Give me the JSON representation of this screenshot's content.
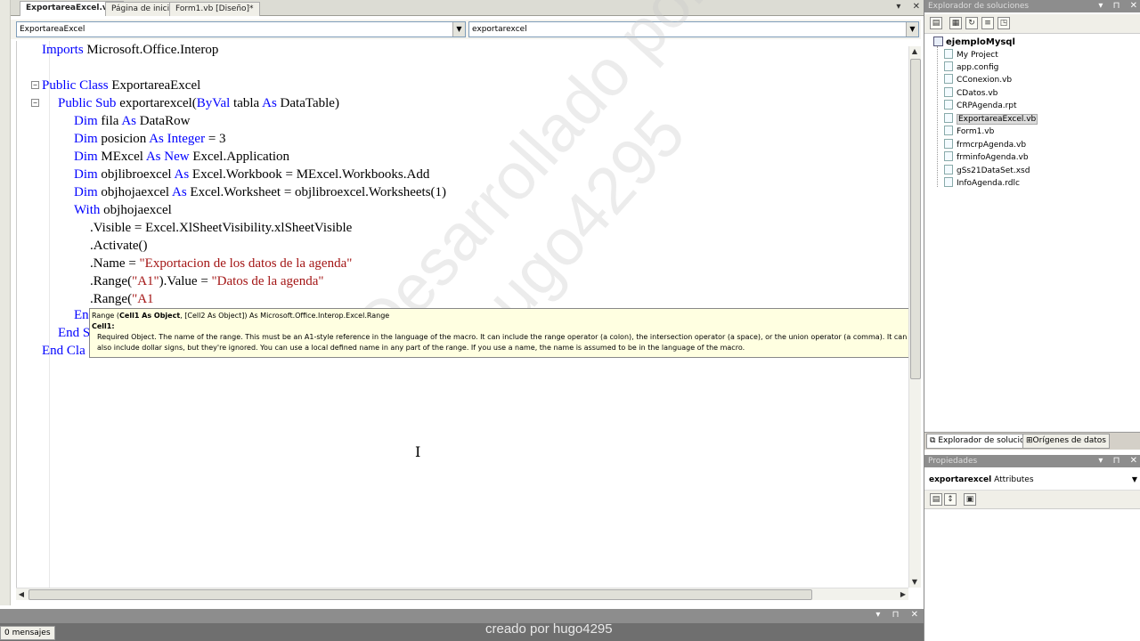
{
  "tabs": [
    {
      "label": "ExportareaExcel.vb*",
      "active": true
    },
    {
      "label": "Página de inicio",
      "active": false
    },
    {
      "label": "Form1.vb [Diseño]*",
      "active": false
    }
  ],
  "navbar": {
    "class_combo": "ExportareaExcel",
    "member_combo": "exportarexcel"
  },
  "code": {
    "l1_kw": "Imports",
    "l1_rest": " Microsoft.Office.Interop",
    "l2_kw": "Public Class",
    "l2_rest": " ExportareaExcel",
    "l3_kw": "Public Sub",
    "l3_rest": " exportarexcel(",
    "l3_kw2": "ByVal",
    "l3_rest2": " tabla ",
    "l3_kw3": "As",
    "l3_rest3": " DataTable)",
    "l4_kw": "Dim",
    "l4_rest": " fila ",
    "l4_kw2": "As",
    "l4_rest2": " DataRow",
    "l5_kw": "Dim",
    "l5_rest": " posicion ",
    "l5_kw2": "As Integer",
    "l5_rest2": " = 3",
    "l6_kw": "Dim",
    "l6_rest": " MExcel ",
    "l6_kw2": "As New",
    "l6_rest2": " Excel.Application",
    "l7_kw": "Dim",
    "l7_rest": " objlibroexcel ",
    "l7_kw2": "As",
    "l7_rest2": " Excel.Workbook = MExcel.Workbooks.Add",
    "l8_kw": "Dim",
    "l8_rest": " objhojaexcel ",
    "l8_kw2": "As",
    "l8_rest2": " Excel.Worksheet = objlibroexcel.Worksheets(1)",
    "l9_kw": "With",
    "l9_rest": " objhojaexcel",
    "l10": ".Visible = Excel.XlSheetVisibility.xlSheetVisible",
    "l11": ".Activate()",
    "l12_a": ".Name = ",
    "l12_str": "\"Exportacion de los datos de la agenda\"",
    "l13_a": ".Range(",
    "l13_str": "\"A1\"",
    "l13_b": ").Value = ",
    "l13_str2": "\"Datos de la agenda\"",
    "l14_a": ".Range(",
    "l14_str": "\"A1",
    "l15": "En",
    "l16": "End S",
    "l17": "End Cla"
  },
  "tooltip": {
    "sig_start": "Range (",
    "sig_param": "Cell1 As Object",
    "sig_end": ", [Cell2 As Object]) As Microsoft.Office.Interop.Excel.Range",
    "param_name": "Cell1:",
    "param_desc": "Required Object. The name of the range. This must be an A1-style reference in the language of the macro. It can include the range operator (a colon), the intersection operator (a space), or the union operator (a comma). It can also include dollar signs, but they're ignored. You can use a local defined name in any part of the range. If you use a name, the name is assumed to be in the language of the macro."
  },
  "watermark": {
    "line1": "Desarrollado por",
    "line2": "hugo4295",
    "footer": "creado por hugo4295"
  },
  "output": {
    "tab_label": "0 mensajes"
  },
  "solution_explorer": {
    "title": "Explorador de soluciones",
    "root": "ejemploMysql",
    "items": [
      "My Project",
      "app.config",
      "CConexion.vb",
      "CDatos.vb",
      "CRPAgenda.rpt",
      "ExportareaExcel.vb",
      "Form1.vb",
      "frmcrpAgenda.vb",
      "frminfoAgenda.vb",
      "gSs21DataSet.xsd",
      "InfoAgenda.rdlc"
    ],
    "selected_index": 5
  },
  "panel_tabs": [
    "Explorador de soluciones",
    "Orígenes de datos"
  ],
  "properties": {
    "title": "Propiedades",
    "object_name": "exportarexcel",
    "object_type": "Attributes"
  },
  "colors": {
    "keyword": "#0000ff",
    "string": "#a31515",
    "tooltip_bg": "#ffffe1"
  }
}
